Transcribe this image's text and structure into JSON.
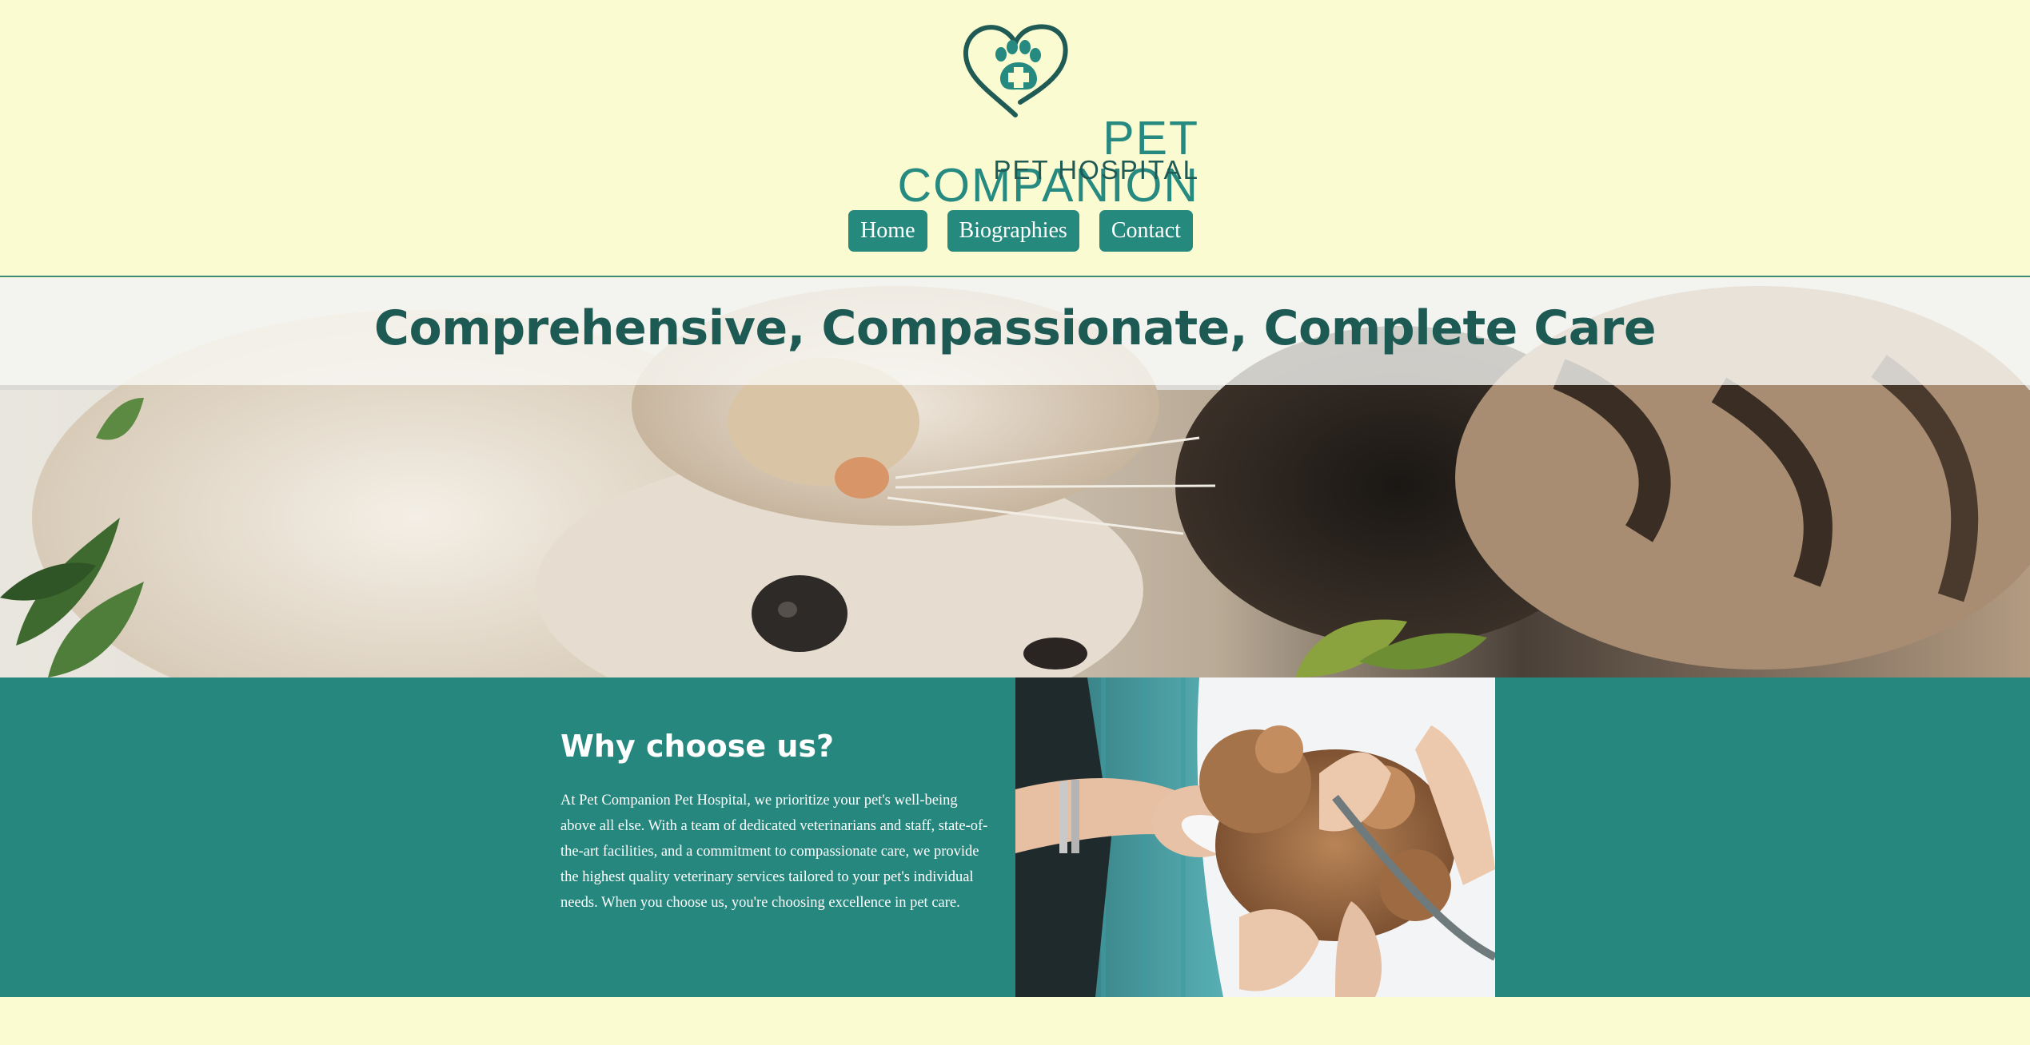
{
  "logo": {
    "title": "PET COMPANION",
    "subtitle": "PET HOSPITAL",
    "primary_color": "#268a80",
    "dark_color": "#1f5a54"
  },
  "nav": {
    "items": [
      {
        "label": "Home"
      },
      {
        "label": "Biographies"
      },
      {
        "label": "Contact"
      }
    ]
  },
  "hero": {
    "title": "Comprehensive, Compassionate, Complete Care"
  },
  "why": {
    "heading": "Why choose us?",
    "body": "At Pet Companion Pet Hospital, we prioritize your pet's well-being above all else. With a team of dedicated veterinarians and staff, state-of-the-art facilities, and a commitment to compassionate care, we provide the highest quality veterinary services tailored to your pet's individual needs. When you choose us, you're choosing excellence in pet care."
  },
  "colors": {
    "background": "#fafbd0",
    "accent": "#25897e",
    "heading": "#1e5a54"
  }
}
